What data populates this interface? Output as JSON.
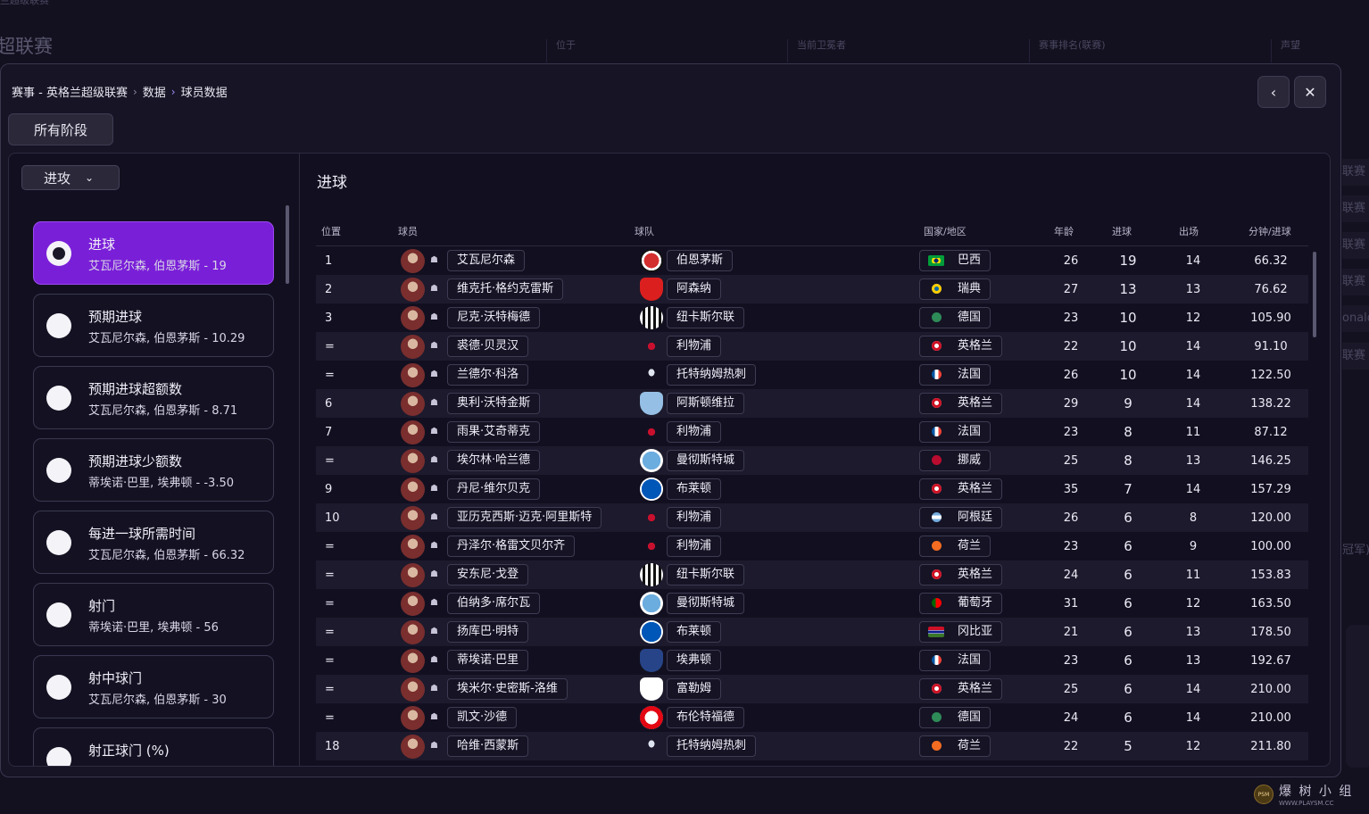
{
  "background": {
    "breadcrumb": "兰超级联赛",
    "title": "超联赛",
    "columns": [
      "位于",
      "当前卫冕者",
      "赛事排名(联赛)",
      "声望"
    ],
    "side_fragments": [
      "联赛",
      "联赛",
      "联赛",
      "联赛",
      "onald",
      "联赛",
      "冠军)"
    ]
  },
  "watermark": {
    "logo_text": "PSM",
    "main": "爆 树 小 组",
    "sub": "WWW.PLAYSM.CC"
  },
  "header": {
    "breadcrumb": [
      "赛事 - 英格兰超级联赛",
      "数据",
      "球员数据"
    ],
    "back_icon": "chevron-left-icon",
    "close_icon": "close-icon"
  },
  "stage_filter": "所有阶段",
  "category_select": "进攻",
  "stat_cards": [
    {
      "name": "进球",
      "leader": "艾瓦尼尔森, 伯恩茅斯 - 19",
      "active": true
    },
    {
      "name": "预期进球",
      "leader": "艾瓦尼尔森, 伯恩茅斯 - 10.29",
      "active": false
    },
    {
      "name": "预期进球超额数",
      "leader": "艾瓦尼尔森, 伯恩茅斯 - 8.71",
      "active": false
    },
    {
      "name": "预期进球少额数",
      "leader": "蒂埃诺·巴里, 埃弗顿 - -3.50",
      "active": false
    },
    {
      "name": "每进一球所需时间",
      "leader": "艾瓦尼尔森, 伯恩茅斯 - 66.32",
      "active": false
    },
    {
      "name": "射门",
      "leader": "蒂埃诺·巴里, 埃弗顿 - 56",
      "active": false
    },
    {
      "name": "射中球门",
      "leader": "艾瓦尼尔森, 伯恩茅斯 - 30",
      "active": false
    },
    {
      "name": "射正球门 (%)",
      "leader": "",
      "active": false
    }
  ],
  "table": {
    "title": "进球",
    "headers": {
      "pos": "位置",
      "player": "球员",
      "team": "球队",
      "nation": "国家/地区",
      "age": "年龄",
      "goals": "进球",
      "apps": "出场",
      "mins_per_goal": "分钟/进球"
    },
    "rows": [
      {
        "pos": "1",
        "player": "艾瓦尼尔森",
        "team": "伯恩茅斯",
        "nation": "巴西",
        "age": "26",
        "goals": "19",
        "apps": "14",
        "mpg": "66.32"
      },
      {
        "pos": "2",
        "player": "维克托·格约克雷斯",
        "team": "阿森纳",
        "nation": "瑞典",
        "age": "27",
        "goals": "13",
        "apps": "13",
        "mpg": "76.62"
      },
      {
        "pos": "3",
        "player": "尼克·沃特梅德",
        "team": "纽卡斯尔联",
        "nation": "德国",
        "age": "23",
        "goals": "10",
        "apps": "12",
        "mpg": "105.90"
      },
      {
        "pos": "=",
        "player": "裘德·贝灵汉",
        "team": "利物浦",
        "nation": "英格兰",
        "age": "22",
        "goals": "10",
        "apps": "14",
        "mpg": "91.10"
      },
      {
        "pos": "=",
        "player": "兰德尔·科洛",
        "team": "托特纳姆热刺",
        "nation": "法国",
        "age": "26",
        "goals": "10",
        "apps": "14",
        "mpg": "122.50"
      },
      {
        "pos": "6",
        "player": "奥利·沃特金斯",
        "team": "阿斯顿维拉",
        "nation": "英格兰",
        "age": "29",
        "goals": "9",
        "apps": "14",
        "mpg": "138.22"
      },
      {
        "pos": "7",
        "player": "雨果·艾奇蒂克",
        "team": "利物浦",
        "nation": "法国",
        "age": "23",
        "goals": "8",
        "apps": "11",
        "mpg": "87.12"
      },
      {
        "pos": "=",
        "player": "埃尔林·哈兰德",
        "team": "曼彻斯特城",
        "nation": "挪威",
        "age": "25",
        "goals": "8",
        "apps": "13",
        "mpg": "146.25"
      },
      {
        "pos": "9",
        "player": "丹尼·维尔贝克",
        "team": "布莱顿",
        "nation": "英格兰",
        "age": "35",
        "goals": "7",
        "apps": "14",
        "mpg": "157.29"
      },
      {
        "pos": "10",
        "player": "亚历克西斯·迈克·阿里斯特",
        "team": "利物浦",
        "nation": "阿根廷",
        "age": "26",
        "goals": "6",
        "apps": "8",
        "mpg": "120.00"
      },
      {
        "pos": "=",
        "player": "丹泽尔·格雷文贝尔齐",
        "team": "利物浦",
        "nation": "荷兰",
        "age": "23",
        "goals": "6",
        "apps": "9",
        "mpg": "100.00"
      },
      {
        "pos": "=",
        "player": "安东尼·戈登",
        "team": "纽卡斯尔联",
        "nation": "英格兰",
        "age": "24",
        "goals": "6",
        "apps": "11",
        "mpg": "153.83"
      },
      {
        "pos": "=",
        "player": "伯纳多·席尔瓦",
        "team": "曼彻斯特城",
        "nation": "葡萄牙",
        "age": "31",
        "goals": "6",
        "apps": "12",
        "mpg": "163.50"
      },
      {
        "pos": "=",
        "player": "扬库巴·明特",
        "team": "布莱顿",
        "nation": "冈比亚",
        "age": "21",
        "goals": "6",
        "apps": "13",
        "mpg": "178.50"
      },
      {
        "pos": "=",
        "player": "蒂埃诺·巴里",
        "team": "埃弗顿",
        "nation": "法国",
        "age": "23",
        "goals": "6",
        "apps": "13",
        "mpg": "192.67"
      },
      {
        "pos": "=",
        "player": "埃米尔·史密斯-洛维",
        "team": "富勒姆",
        "nation": "英格兰",
        "age": "25",
        "goals": "6",
        "apps": "14",
        "mpg": "210.00"
      },
      {
        "pos": "=",
        "player": "凯文·沙德",
        "team": "布伦特福德",
        "nation": "德国",
        "age": "24",
        "goals": "6",
        "apps": "14",
        "mpg": "210.00"
      },
      {
        "pos": "18",
        "player": "哈维·西蒙斯",
        "team": "托特纳姆热刺",
        "nation": "荷兰",
        "age": "22",
        "goals": "5",
        "apps": "12",
        "mpg": "211.80"
      }
    ]
  },
  "colors": {
    "accent": "#7a1fd8",
    "bg": "#161425",
    "row_alt": "#1c1a2c"
  }
}
